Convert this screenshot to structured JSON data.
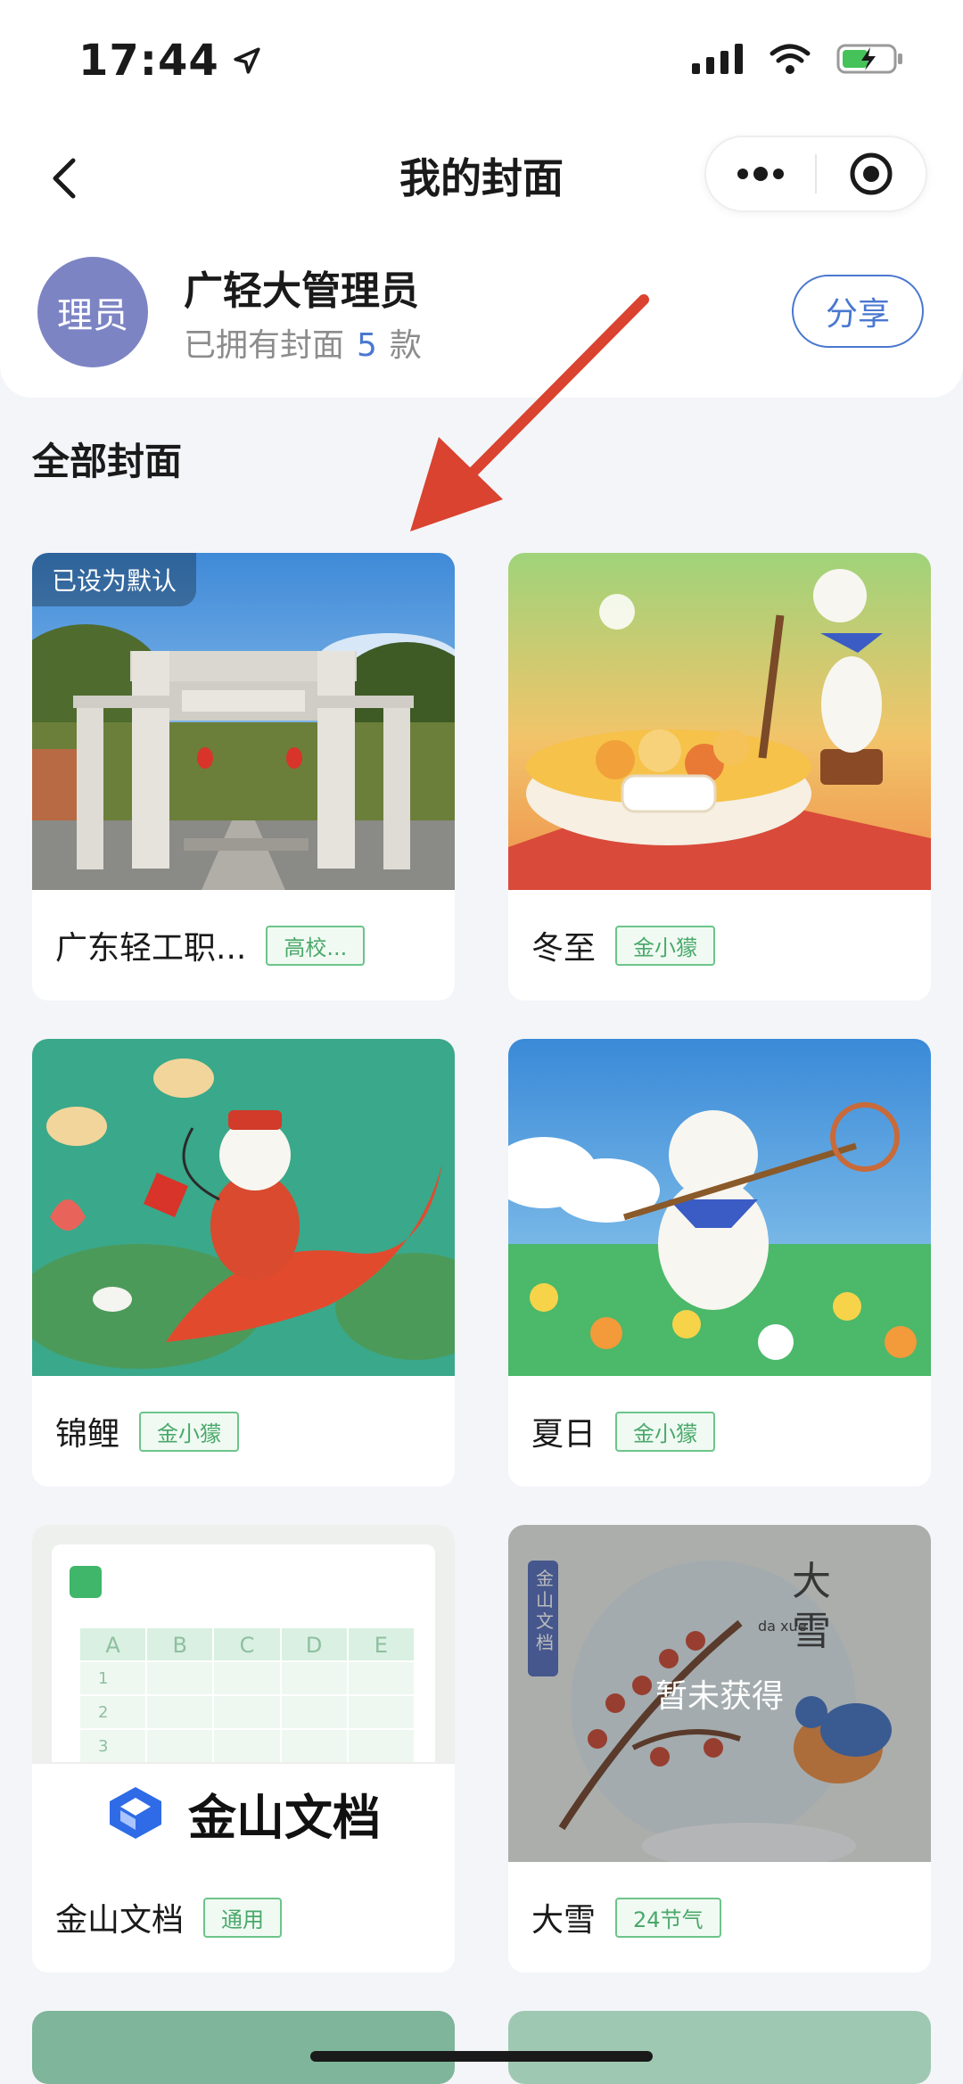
{
  "status_bar": {
    "time": "17:44"
  },
  "nav": {
    "title": "我的封面"
  },
  "profile": {
    "avatar_text": "理员",
    "name": "广轻大管理员",
    "owned_prefix": "已拥有封面",
    "owned_count": "5",
    "owned_suffix": "款",
    "share_label": "分享"
  },
  "section_title": "全部封面",
  "covers": [
    {
      "name": "广东轻工职...",
      "tag": "高校...",
      "badge": "已设为默认",
      "image": "campus-gate"
    },
    {
      "name": "冬至",
      "tag": "金小獴",
      "image": "tangyuan-bowl"
    },
    {
      "name": "锦鲤",
      "tag": "金小獴",
      "image": "koi-lotus"
    },
    {
      "name": "夏日",
      "tag": "金小獴",
      "image": "summer-meadow"
    },
    {
      "name": "金山文档",
      "tag": "通用",
      "image": "kingsoft-docs",
      "logo_text": "金山文档",
      "sheet_cols": [
        "A",
        "B",
        "C",
        "D",
        "E"
      ],
      "sheet_rows": [
        "1",
        "2",
        "3"
      ]
    },
    {
      "name": "大雪",
      "tag": "24节气",
      "image": "heavy-snow",
      "overlay": "暂未获得",
      "art_text": "大雪",
      "pinyin": "da xue",
      "side_label": "金山文档"
    }
  ],
  "colors": {
    "accent": "#4a78d0",
    "tag_green": "#6cc48a",
    "annotation_red": "#d9432f"
  }
}
